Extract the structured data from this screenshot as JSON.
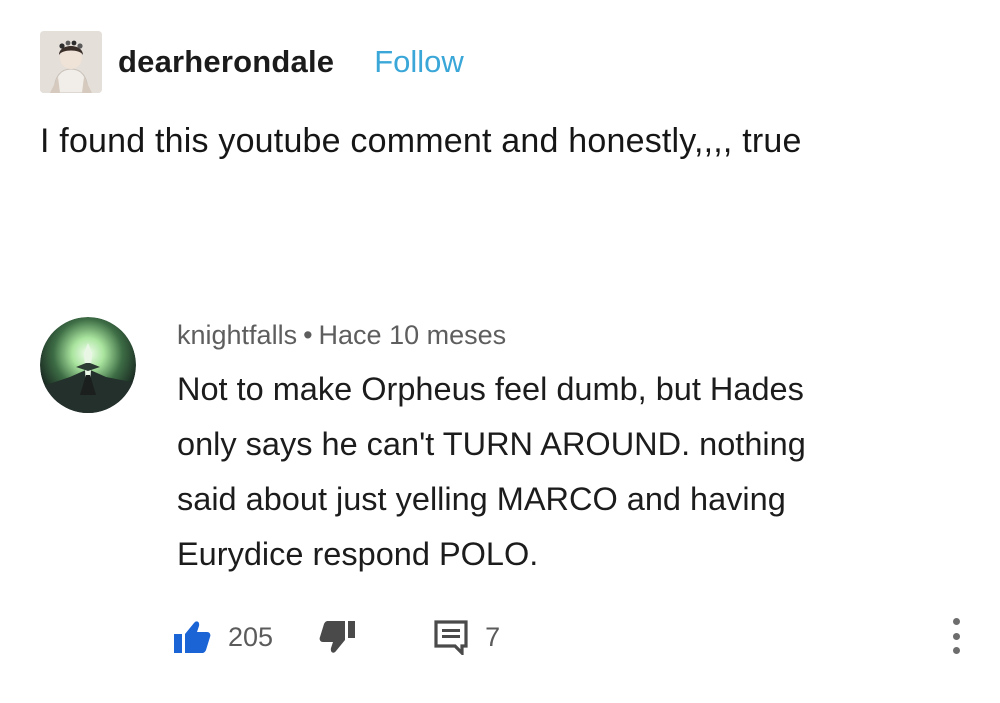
{
  "post": {
    "username": "dearherondale",
    "follow_label": "Follow",
    "caption": "I found this youtube comment and honestly,,,, true"
  },
  "comment": {
    "author": "knightfalls",
    "separator": "•",
    "time": "Hace 10 meses",
    "lines": [
      "Not to make Orpheus feel dumb, but Hades",
      "only says he can't TURN AROUND. nothing",
      "said about just yelling MARCO and having",
      "Eurydice respond POLO."
    ],
    "likes": "205",
    "replies": "7"
  },
  "icons": {
    "like": "thumbs-up-icon",
    "dislike": "thumbs-down-icon",
    "reply": "comment-icon",
    "more": "more-vertical-icon"
  },
  "colors": {
    "follow": "#3aa7d8",
    "like_active": "#1a64d6",
    "meta_text": "#5e5e5e"
  }
}
